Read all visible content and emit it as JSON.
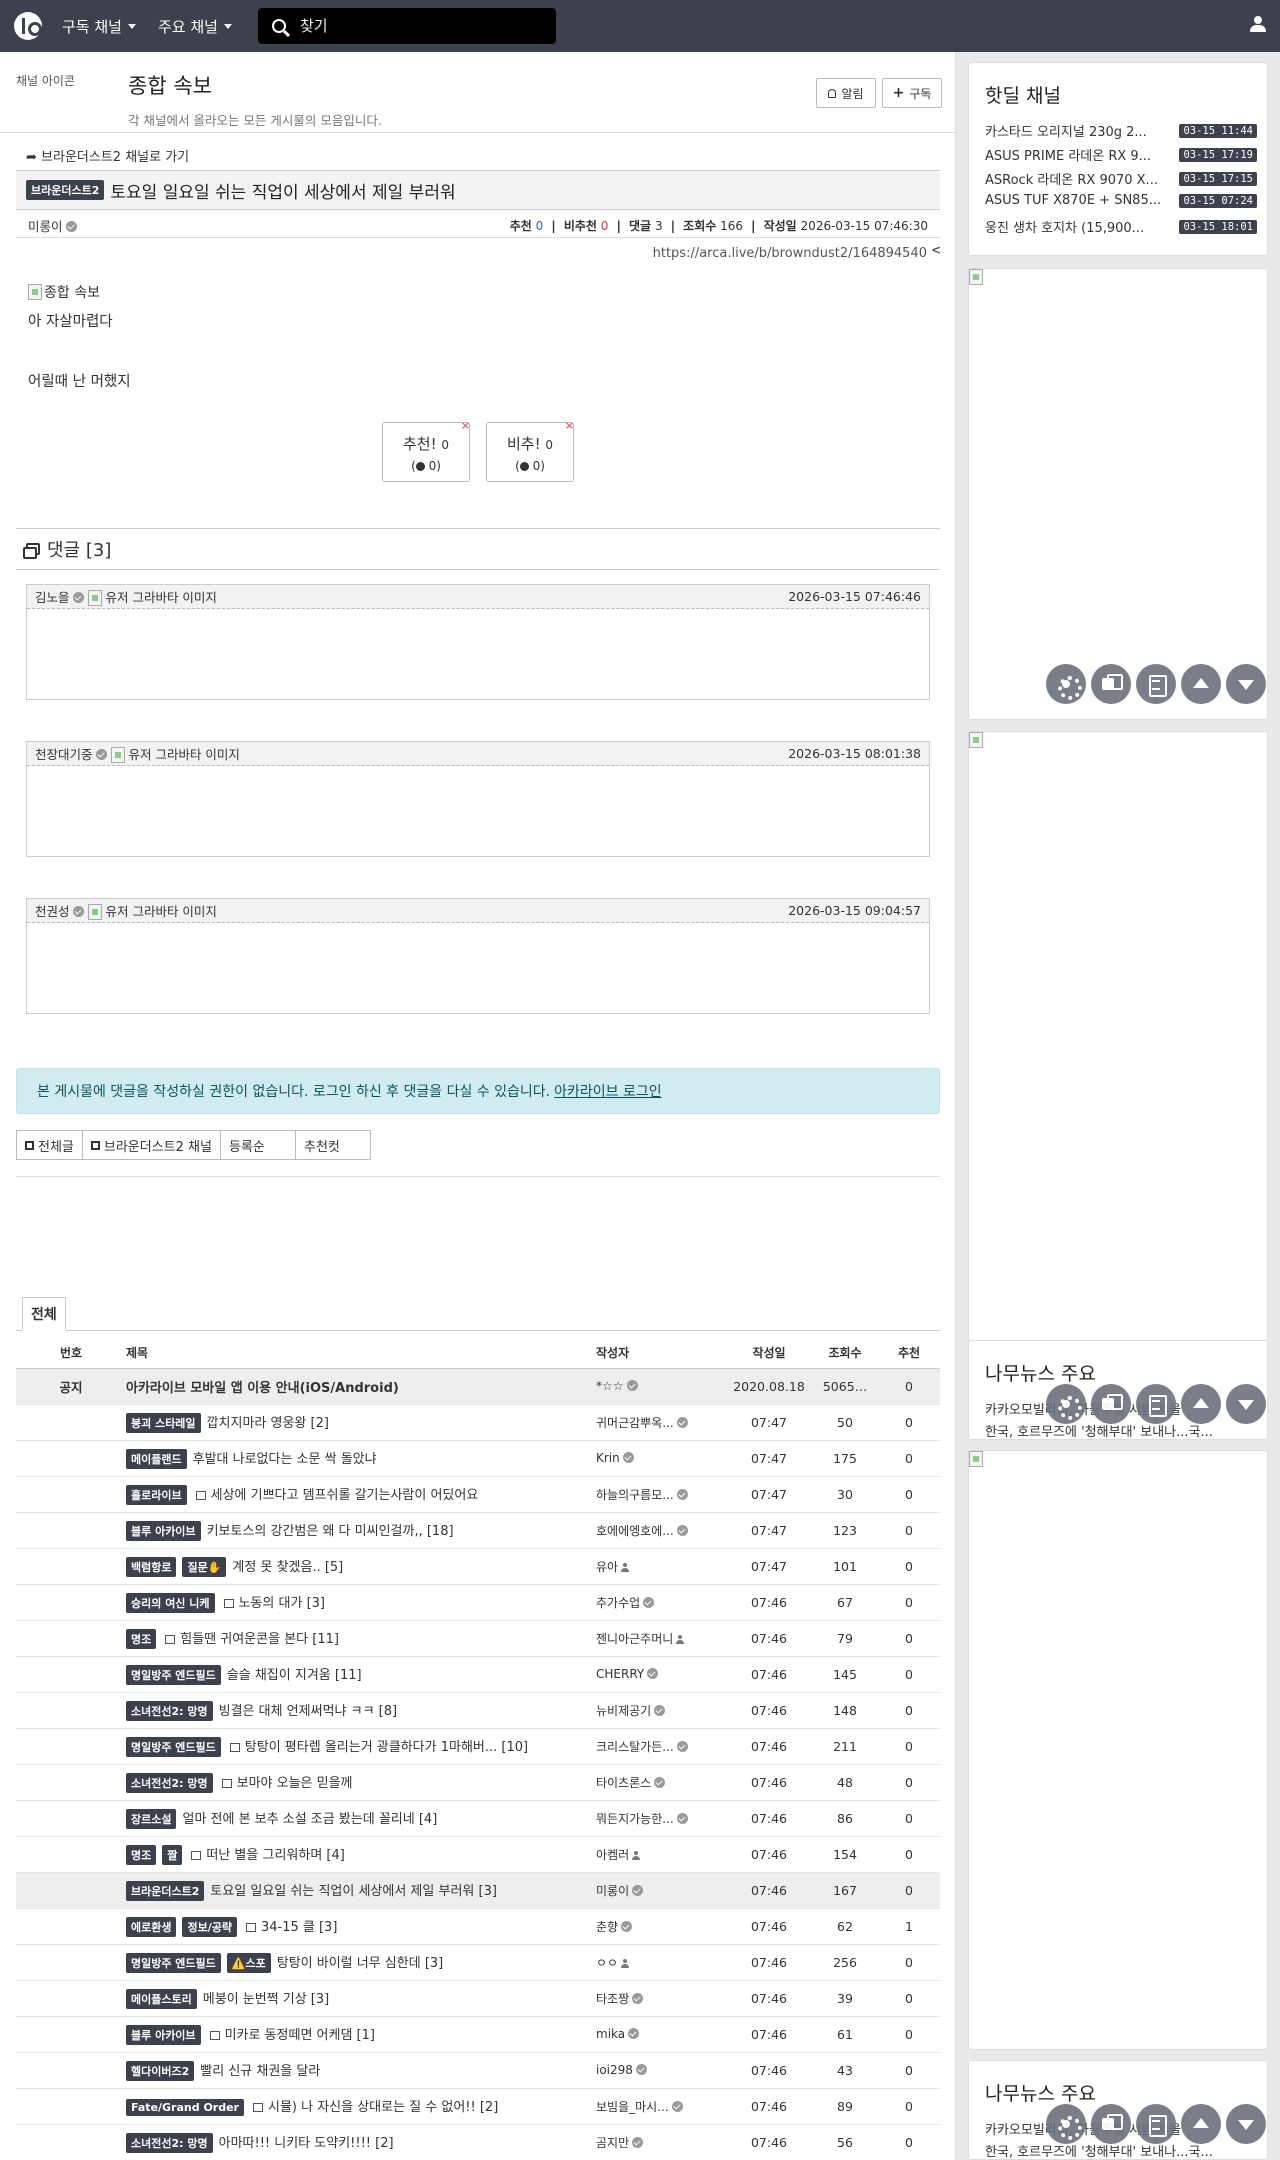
{
  "nav": {
    "subscribed_channels": "구독 채널",
    "main_channels": "주요 채널",
    "search_placeholder": "찾기"
  },
  "board": {
    "icon_alt": "채널 아이콘",
    "title": "종합 속보",
    "description": "각 채널에서 올라오는 모든 게시물의 모음입니다.",
    "alarm_label": "알림",
    "subscribe_label": "구독"
  },
  "article": {
    "goto_link": "브라운더스트2 채널로 가기",
    "category": "브라운더스트2",
    "title": "토요일 일요일 쉬는 직업이 세상에서 제일 부러워",
    "author": "미롱이",
    "labels": {
      "up": "추천",
      "down": "비추천",
      "comments": "댓글",
      "views": "조회수",
      "date": "작성일"
    },
    "up": "0",
    "down": "0",
    "comments": "3",
    "views": "166",
    "date": "2026-03-15 07:46:30",
    "url": "https://arca.live/b/browndust2/164894540",
    "image_alt": "종합 속보",
    "body_line1": "아 자살마렵다",
    "body_line2": "어릴때 난 머했지",
    "vote_up_label": "추천!",
    "vote_up_count": "0",
    "vote_up_sub": "0",
    "vote_down_label": "비추!",
    "vote_down_count": "0",
    "vote_down_sub": "0"
  },
  "comments": {
    "header": "댓글 [3]",
    "avatar_alt": "유저 그라바타 이미지",
    "items": [
      {
        "author": "김노을",
        "date": "2026-03-15 07:46:46"
      },
      {
        "author": "천장대기중",
        "date": "2026-03-15 08:01:38"
      },
      {
        "author": "천권성",
        "date": "2026-03-15 09:04:57"
      }
    ]
  },
  "login_alert": {
    "text": "본 게시물에 댓글을 작성하실 권한이 없습니다. 로그인 하신 후 댓글을 다실 수 있습니다.",
    "link": "아카라이브 로그인"
  },
  "list_tabs": {
    "all_posts": "전체글",
    "channel": "브라운더스트2 채널",
    "order": "등록순",
    "recommend": "추천컷"
  },
  "list": {
    "tab": "전체",
    "columns": [
      "번호",
      "제목",
      "작성자",
      "작성일",
      "조회수",
      "추천"
    ],
    "notice": {
      "label": "공지",
      "title": "아카라이브 모바일 앱 이용 안내(iOS/Android)",
      "author": "*☆☆",
      "date": "2020.08.18",
      "views": "5065…",
      "rec": "0"
    },
    "rows": [
      {
        "badge": "붕괴 스타레일",
        "tag": "",
        "img": false,
        "title": "깝치지마라 영웅왕 [2]",
        "author": "귀머근감뿌옥...",
        "verified": true,
        "date": "07:47",
        "views": "50",
        "rec": "0"
      },
      {
        "badge": "메이플랜드",
        "tag": "",
        "img": false,
        "title": "후발대 나로없다는 소문 싹 돌았냐",
        "author": "Krin",
        "verified": true,
        "date": "07:47",
        "views": "175",
        "rec": "0"
      },
      {
        "badge": "홀로라이브",
        "tag": "",
        "img": true,
        "title": "세상에 기쁘다고 뎀프쉬롤 갈기는사람이 어딨어요",
        "author": "하늘의구름모...",
        "verified": true,
        "date": "07:47",
        "views": "30",
        "rec": "0"
      },
      {
        "badge": "블루 아카이브",
        "tag": "",
        "img": false,
        "title": "키보토스의 강간범은 왜 다 미씨인걸까,, [18]",
        "author": "호에에엥호에...",
        "verified": true,
        "date": "07:47",
        "views": "123",
        "rec": "0"
      },
      {
        "badge": "백럼항로",
        "tag": "질문✋",
        "img": false,
        "title": "계정 못 찾겠음.. [5]",
        "author": "유아",
        "verified": false,
        "date": "07:47",
        "views": "101",
        "rec": "0"
      },
      {
        "badge": "승리의 여신 니케",
        "tag": "",
        "img": true,
        "title": "노동의 대가 [3]",
        "author": "추가수업",
        "verified": true,
        "date": "07:46",
        "views": "67",
        "rec": "0"
      },
      {
        "badge": "명조",
        "tag": "",
        "img": true,
        "title": "힘들땐 귀여운콘을 본다 [11]",
        "author": "젠니아근주머니",
        "verified": false,
        "date": "07:46",
        "views": "79",
        "rec": "0"
      },
      {
        "badge": "명일방주 엔드필드",
        "tag": "",
        "img": false,
        "title": "슬슬 채집이 지겨움 [11]",
        "author": "CHERRY",
        "verified": true,
        "date": "07:46",
        "views": "145",
        "rec": "0"
      },
      {
        "badge": "소녀전선2: 망명",
        "tag": "",
        "img": false,
        "title": "빙결은 대체 언제써먹냐 ㅋㅋ [8]",
        "author": "뉴비제공기",
        "verified": true,
        "date": "07:46",
        "views": "148",
        "rec": "0"
      },
      {
        "badge": "명일방주 엔드필드",
        "tag": "",
        "img": true,
        "title": "탕탕이 평타렙 올리는거 광클하다가 1마해버... [10]",
        "author": "크리스탈가든...",
        "verified": true,
        "date": "07:46",
        "views": "211",
        "rec": "0"
      },
      {
        "badge": "소녀전선2: 망명",
        "tag": "",
        "img": true,
        "title": "보마야 오늘은 믿을께",
        "author": "타이츠론스",
        "verified": true,
        "date": "07:46",
        "views": "48",
        "rec": "0"
      },
      {
        "badge": "장르소설",
        "tag": "",
        "img": false,
        "title": "얼마 전에 본 보추 소설 조금 봤는데 꼴리네 [4]",
        "author": "뭐든지가능한...",
        "verified": true,
        "date": "07:46",
        "views": "86",
        "rec": "0"
      },
      {
        "badge": "명조",
        "tag": "짤",
        "img": true,
        "title": "떠난 별을 그리워하며 [4]",
        "author": "아켐러",
        "verified": false,
        "date": "07:46",
        "views": "154",
        "rec": "0"
      },
      {
        "badge": "브라운더스트2",
        "tag": "",
        "img": false,
        "title": "토요일 일요일 쉬는 직업이 세상에서 제일 부러워 [3]",
        "author": "미롱이",
        "verified": true,
        "date": "07:46",
        "views": "167",
        "rec": "0",
        "highlight": true
      },
      {
        "badge": "에로환생",
        "tag": "정보/공략",
        "img": true,
        "title": "34-15 클 [3]",
        "author": "춘향",
        "verified": true,
        "date": "07:46",
        "views": "62",
        "rec": "1"
      },
      {
        "badge": "명일방주 엔드필드",
        "tag": "⚠️스포",
        "img": false,
        "title": "탕탕이 바이럴 너무 심한데 [3]",
        "author": "ㅇㅇ",
        "verified": false,
        "date": "07:46",
        "views": "256",
        "rec": "0"
      },
      {
        "badge": "메이플스토리",
        "tag": "",
        "img": false,
        "title": "메붕이 눈번쩍 기상 [3]",
        "author": "타조짱",
        "verified": true,
        "date": "07:46",
        "views": "39",
        "rec": "0"
      },
      {
        "badge": "블루 아카이브",
        "tag": "",
        "img": true,
        "title": "미카로 동정떼면 어케댐 [1]",
        "author": "mika",
        "verified": true,
        "date": "07:46",
        "views": "61",
        "rec": "0"
      },
      {
        "badge": "헬다이버즈2",
        "tag": "",
        "img": false,
        "title": "빨리 신규 채권을 달라",
        "author": "ioi298",
        "verified": true,
        "date": "07:46",
        "views": "43",
        "rec": "0"
      },
      {
        "badge": "Fate/Grand Order",
        "tag": "",
        "img": true,
        "title": "시뮬) 나 자신을 상대로는 질 수 없어!! [2]",
        "author": "보빔을_마시...",
        "verified": true,
        "date": "07:46",
        "views": "89",
        "rec": "0"
      },
      {
        "badge": "소녀전선2: 망명",
        "tag": "",
        "img": false,
        "title": "아마따!!! 니키타 도약키!!!! [2]",
        "author": "곰지만",
        "verified": true,
        "date": "07:46",
        "views": "56",
        "rec": "0"
      }
    ]
  },
  "sidebar": {
    "hot_title": "핫딜 채널",
    "hot_items": [
      {
        "text": "카스타드 오리지널 230g 2...",
        "time": "03-15 11:44"
      },
      {
        "text": "ASUS PRIME 라데온 RX 9...",
        "time": "03-15 17:19"
      },
      {
        "text": "ASRock 라데온 RX 9070 X...",
        "time": "03-15 17:15"
      },
      {
        "text": "ASUS TUF X870E + SN85...",
        "time": "03-15 07:24"
      },
      {
        "text": "웅진 생차 호지차 (15,900...",
        "time": "03-15 18:01"
      }
    ],
    "news1_title": "나무뉴스 주요",
    "news1_line1": "카카오모빌리티, 자율주행 시범 서울",
    "news1_line2": "한국, 호르무즈에 '청해부대' 보내나...국...",
    "news2_title": "나무뉴스 주요",
    "news2_line1": "카카오모빌리티, 자율주행 시범 서울",
    "news2_line2": "한국, 호르무즈에 '청해부대' 보내나...국..."
  },
  "colors": {
    "nav_bg": "#3d414d",
    "badge_bg": "#3d414d",
    "alert_bg": "#d1ecf1",
    "blue": "#2a65c9",
    "red": "#d43a3a"
  }
}
